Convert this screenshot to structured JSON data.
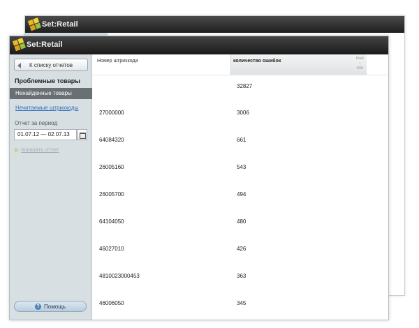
{
  "app": {
    "name": "Set:Retail"
  },
  "sidebar": {
    "back_button": "К списку отчетов",
    "heading": "Проблемные товары",
    "active_item": "Ненайденные товары",
    "link_item": "Нечитаемые штрихкоды",
    "period_label": "Отчет за период",
    "period_value": "01.07.12 — 02.07.13",
    "show_report": "показать отчет",
    "help_button": "Помощь"
  },
  "table": {
    "columns": [
      "Номер штрихкода",
      "количество ошибок"
    ],
    "sorter": {
      "max": "max",
      "min": "min"
    },
    "rows": [
      {
        "barcode": "",
        "errors": "32827"
      },
      {
        "barcode": "27000000",
        "errors": "3006"
      },
      {
        "barcode": "64084320",
        "errors": "661"
      },
      {
        "barcode": "26005160",
        "errors": "543"
      },
      {
        "barcode": "26005700",
        "errors": "494"
      },
      {
        "barcode": "64104050",
        "errors": "480"
      },
      {
        "barcode": "46027010",
        "errors": "426"
      },
      {
        "barcode": "4810023000453",
        "errors": "363"
      },
      {
        "barcode": "46006050",
        "errors": "345"
      }
    ]
  },
  "colors": {
    "titlebar": "#1f1f1f",
    "sidebar_bg": "#d8dfe3",
    "active_item_bg": "#6a6f73",
    "link": "#2f6fb8"
  }
}
